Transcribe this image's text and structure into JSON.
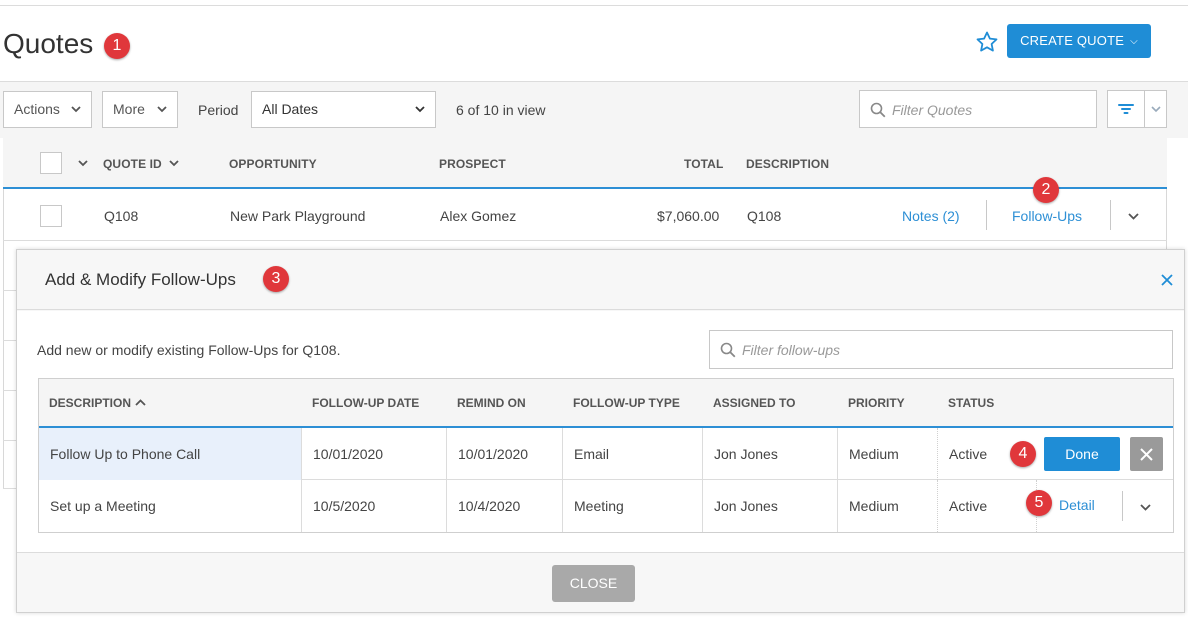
{
  "page": {
    "title": "Quotes",
    "create_quote_label": "CREATE QUOTE"
  },
  "toolbar": {
    "actions_label": "Actions",
    "more_label": "More",
    "period_label": "Period",
    "period_value": "All Dates",
    "in_view_text": "6 of 10 in view",
    "filter_placeholder": "Filter Quotes"
  },
  "grid": {
    "columns": [
      "QUOTE ID",
      "OPPORTUNITY",
      "PROSPECT",
      "TOTAL",
      "DESCRIPTION"
    ],
    "rows": [
      {
        "quote_id": "Q108",
        "opportunity": "New Park Playground",
        "prospect": "Alex Gomez",
        "total": "$7,060.00",
        "description": "Q108",
        "notes_link": "Notes (2)",
        "followups_link": "Follow-Ups"
      }
    ]
  },
  "modal": {
    "title": "Add & Modify Follow-Ups",
    "intro": "Add new or modify existing Follow-Ups for Q108.",
    "filter_placeholder": "Filter follow-ups",
    "columns": [
      "DESCRIPTION",
      "FOLLOW-UP DATE",
      "REMIND ON",
      "FOLLOW-UP TYPE",
      "ASSIGNED TO",
      "PRIORITY",
      "STATUS"
    ],
    "rows": [
      {
        "description": "Follow Up to Phone Call",
        "followup_date": "10/01/2020",
        "remind_on": "10/01/2020",
        "type": "Email",
        "assigned_to": "Jon Jones",
        "priority": "Medium",
        "status": "Active",
        "action_label": "Done"
      },
      {
        "description": "Set up a Meeting",
        "followup_date": "10/5/2020",
        "remind_on": "10/4/2020",
        "type": "Meeting",
        "assigned_to": "Jon Jones",
        "priority": "Medium",
        "status": "Active",
        "action_label": "Detail"
      }
    ],
    "close_label": "CLOSE"
  },
  "annotations": [
    "1",
    "2",
    "3",
    "4",
    "5"
  ],
  "colors": {
    "accent": "#1f8dd6",
    "badge": "#e0373b",
    "selected_row": "#e8f0fb"
  },
  "icons": [
    "star-icon",
    "chevron-down-icon",
    "search-icon",
    "filter-icon",
    "close-icon",
    "sort-asc-icon"
  ]
}
